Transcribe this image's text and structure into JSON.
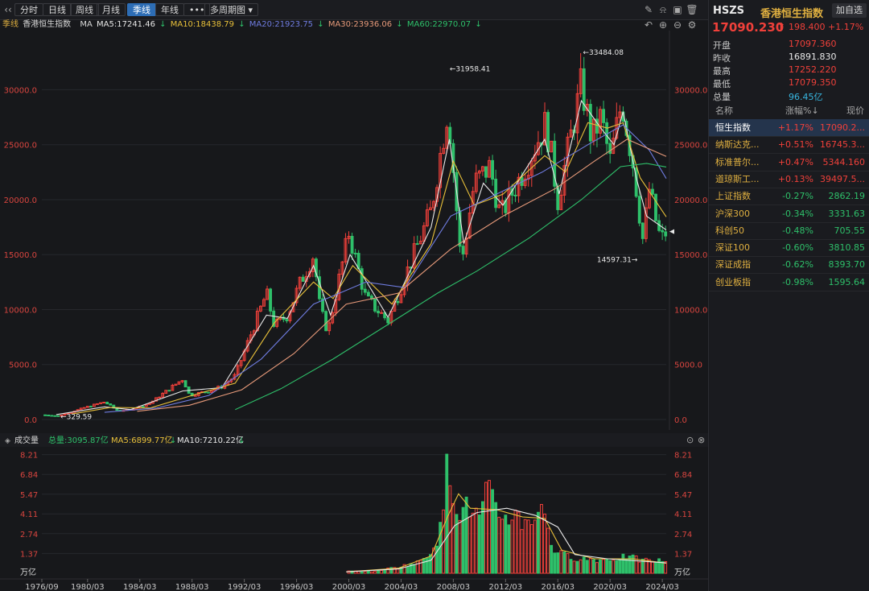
{
  "toolbar": {
    "periods": [
      "分时",
      "日线",
      "周线",
      "月线",
      "季线",
      "年线"
    ],
    "active_period": "季线",
    "more_label": "•••",
    "multi_period_label": "多周期图"
  },
  "ma_bar": {
    "period_label": "季线",
    "index_name": "香港恒生指数",
    "ma_label": "MA",
    "ma5": "MA5:17241.46",
    "ma10": "MA10:18438.79",
    "ma20": "MA20:21923.75",
    "ma30": "MA30:23936.06",
    "ma60": "MA60:22970.07",
    "down_arrow": "↓"
  },
  "volume_bar": {
    "title": "成交量",
    "total": "总量:3095.87亿",
    "ma5": "MA5:6899.77亿",
    "ma10": "MA10:7210.22亿",
    "down_arrow": "↓"
  },
  "colors": {
    "up": "#f0403a",
    "down": "#2ec06a",
    "ma5": "#e8e8e8",
    "ma10": "#e8c03a",
    "ma20": "#6f7ce0",
    "ma30": "#e79a7a",
    "ma60": "#2ec06a",
    "accent": "#2d6db5"
  },
  "quote": {
    "code": "HSZS",
    "name": "香港恒生指数",
    "add_label": "加自选",
    "price": "17090.230",
    "change": "198.400",
    "change_pct": "+1.17%",
    "fields": [
      {
        "label": "开盘",
        "value": "17097.360"
      },
      {
        "label": "昨收",
        "value": "16891.830"
      },
      {
        "label": "最高",
        "value": "17252.220"
      },
      {
        "label": "最低",
        "value": "17079.350"
      },
      {
        "label": "总量",
        "value": "96.45亿"
      }
    ]
  },
  "index_table": {
    "headers": [
      "名称",
      "涨幅%↓",
      "现价"
    ],
    "rows": [
      {
        "name": "恒生指数",
        "pct": "+1.17%",
        "price": "17090.2..."
      },
      {
        "name": "纳斯达克...",
        "pct": "+0.51%",
        "price": "16745.3..."
      },
      {
        "name": "标准普尔...",
        "pct": "+0.47%",
        "price": "5344.160"
      },
      {
        "name": "道琼斯工...",
        "pct": "+0.13%",
        "price": "39497.5..."
      },
      {
        "name": "上证指数",
        "pct": "-0.27%",
        "price": "2862.19"
      },
      {
        "name": "沪深300",
        "pct": "-0.34%",
        "price": "3331.63"
      },
      {
        "name": "科创50",
        "pct": "-0.48%",
        "price": "705.55"
      },
      {
        "name": "深证100",
        "pct": "-0.60%",
        "price": "3810.85"
      },
      {
        "name": "深证成指",
        "pct": "-0.62%",
        "price": "8393.70"
      },
      {
        "name": "创业板指",
        "pct": "-0.98%",
        "price": "1595.64"
      }
    ]
  },
  "chart_data": {
    "type": "candlestick",
    "price_axis": {
      "ticks": [
        0,
        5000,
        10000,
        15000,
        20000,
        25000,
        30000
      ],
      "tick_labels": [
        "0.0",
        "5000.0",
        "10000.0",
        "15000.0",
        "20000.0",
        "25000.0",
        "30000.0"
      ],
      "ylim": [
        0,
        34500
      ]
    },
    "volume_axis": {
      "ticks": [
        1.37,
        2.74,
        4.11,
        5.47,
        6.84,
        8.21
      ],
      "tick_labels": [
        "1.37",
        "2.74",
        "4.11",
        "5.47",
        "6.84",
        "8.21"
      ],
      "unit": "万亿",
      "ylim": [
        0,
        8.3
      ]
    },
    "x_labels": [
      "1976/09",
      "1980/03",
      "1984/03",
      "1988/03",
      "1992/03",
      "1996/03",
      "2000/03",
      "2004/03",
      "2008/03",
      "2012/03",
      "2016/03",
      "2020/03",
      "2024/03"
    ],
    "x_range": [
      1976.7,
      2024.5
    ],
    "annotations": [
      {
        "text": "329.59",
        "x": 1978.0,
        "y": 329.59
      },
      {
        "text": "31958.41",
        "x": 2007.8,
        "y": 31958.41
      },
      {
        "text": "33484.08",
        "x": 2018.0,
        "y": 33484.08
      },
      {
        "text": "14597.31",
        "x": 2022.8,
        "y": 14597.31
      }
    ],
    "last_price": 17090.23,
    "close_series": [
      {
        "x": 1976.7,
        "y": 420
      },
      {
        "x": 1978.0,
        "y": 330
      },
      {
        "x": 1979.0,
        "y": 700
      },
      {
        "x": 1980.0,
        "y": 1100
      },
      {
        "x": 1981.5,
        "y": 1600
      },
      {
        "x": 1982.5,
        "y": 800
      },
      {
        "x": 1983.5,
        "y": 900
      },
      {
        "x": 1985.0,
        "y": 1500
      },
      {
        "x": 1987.5,
        "y": 3700
      },
      {
        "x": 1988.0,
        "y": 2200
      },
      {
        "x": 1989.5,
        "y": 2600
      },
      {
        "x": 1990.5,
        "y": 3000
      },
      {
        "x": 1991.5,
        "y": 4000
      },
      {
        "x": 1993.9,
        "y": 11500
      },
      {
        "x": 1994.5,
        "y": 8500
      },
      {
        "x": 1995.5,
        "y": 9500
      },
      {
        "x": 1996.5,
        "y": 12500
      },
      {
        "x": 1997.5,
        "y": 15000
      },
      {
        "x": 1998.0,
        "y": 10000
      },
      {
        "x": 1998.6,
        "y": 8000
      },
      {
        "x": 2000.2,
        "y": 17000
      },
      {
        "x": 2001.5,
        "y": 11000
      },
      {
        "x": 2003.2,
        "y": 9000
      },
      {
        "x": 2004.5,
        "y": 13000
      },
      {
        "x": 2006.5,
        "y": 19000
      },
      {
        "x": 2007.8,
        "y": 28500
      },
      {
        "x": 2008.8,
        "y": 14000
      },
      {
        "x": 2009.8,
        "y": 21500
      },
      {
        "x": 2011.0,
        "y": 23000
      },
      {
        "x": 2011.8,
        "y": 18500
      },
      {
        "x": 2013.5,
        "y": 22500
      },
      {
        "x": 2015.3,
        "y": 27000
      },
      {
        "x": 2016.2,
        "y": 20000
      },
      {
        "x": 2018.0,
        "y": 30500
      },
      {
        "x": 2018.8,
        "y": 25500
      },
      {
        "x": 2019.5,
        "y": 27500
      },
      {
        "x": 2020.2,
        "y": 23500
      },
      {
        "x": 2021.1,
        "y": 29000
      },
      {
        "x": 2022.0,
        "y": 23000
      },
      {
        "x": 2022.8,
        "y": 15500
      },
      {
        "x": 2023.1,
        "y": 21500
      },
      {
        "x": 2023.9,
        "y": 17000
      },
      {
        "x": 2024.2,
        "y": 16500
      },
      {
        "x": 2024.5,
        "y": 17090
      }
    ],
    "ma_series": [
      {
        "name": "MA5",
        "points": [
          {
            "x": 1977.8,
            "y": 450
          },
          {
            "x": 1981.5,
            "y": 1150
          },
          {
            "x": 1983.5,
            "y": 900
          },
          {
            "x": 1987.5,
            "y": 2600
          },
          {
            "x": 1990.5,
            "y": 2900
          },
          {
            "x": 1993.9,
            "y": 9500
          },
          {
            "x": 1995.5,
            "y": 9200
          },
          {
            "x": 1997.5,
            "y": 14000
          },
          {
            "x": 1998.8,
            "y": 9500
          },
          {
            "x": 2000.3,
            "y": 15000
          },
          {
            "x": 2003.2,
            "y": 9300
          },
          {
            "x": 2006.5,
            "y": 17500
          },
          {
            "x": 2007.9,
            "y": 25500
          },
          {
            "x": 2009.0,
            "y": 16000
          },
          {
            "x": 2010.5,
            "y": 21500
          },
          {
            "x": 2012.0,
            "y": 19500
          },
          {
            "x": 2015.2,
            "y": 25500
          },
          {
            "x": 2016.3,
            "y": 20500
          },
          {
            "x": 2018.0,
            "y": 29000
          },
          {
            "x": 2019.5,
            "y": 26500
          },
          {
            "x": 2020.5,
            "y": 25000
          },
          {
            "x": 2021.2,
            "y": 28000
          },
          {
            "x": 2022.2,
            "y": 22000
          },
          {
            "x": 2023.0,
            "y": 18500
          },
          {
            "x": 2024.5,
            "y": 17241
          }
        ]
      },
      {
        "name": "MA10",
        "points": [
          {
            "x": 1979.0,
            "y": 500
          },
          {
            "x": 1982.0,
            "y": 1100
          },
          {
            "x": 1985.0,
            "y": 1050
          },
          {
            "x": 1988.5,
            "y": 2300
          },
          {
            "x": 1991.5,
            "y": 3300
          },
          {
            "x": 1994.5,
            "y": 8800
          },
          {
            "x": 1997.5,
            "y": 12500
          },
          {
            "x": 1999.0,
            "y": 11000
          },
          {
            "x": 2000.5,
            "y": 14000
          },
          {
            "x": 2003.5,
            "y": 10500
          },
          {
            "x": 2006.5,
            "y": 16000
          },
          {
            "x": 2008.2,
            "y": 23500
          },
          {
            "x": 2009.8,
            "y": 19500
          },
          {
            "x": 2012.0,
            "y": 20500
          },
          {
            "x": 2015.2,
            "y": 24000
          },
          {
            "x": 2016.8,
            "y": 22500
          },
          {
            "x": 2018.5,
            "y": 27000
          },
          {
            "x": 2020.0,
            "y": 26500
          },
          {
            "x": 2021.2,
            "y": 27000
          },
          {
            "x": 2022.5,
            "y": 22000
          },
          {
            "x": 2024.5,
            "y": 18438
          }
        ]
      },
      {
        "name": "MA20",
        "points": [
          {
            "x": 1981.5,
            "y": 650
          },
          {
            "x": 1985.5,
            "y": 1050
          },
          {
            "x": 1989.5,
            "y": 2200
          },
          {
            "x": 1993.5,
            "y": 5500
          },
          {
            "x": 1997.5,
            "y": 10500
          },
          {
            "x": 2001.5,
            "y": 12500
          },
          {
            "x": 2004.5,
            "y": 12000
          },
          {
            "x": 2008.0,
            "y": 18500
          },
          {
            "x": 2011.5,
            "y": 20500
          },
          {
            "x": 2015.0,
            "y": 22500
          },
          {
            "x": 2018.5,
            "y": 25000
          },
          {
            "x": 2021.2,
            "y": 26800
          },
          {
            "x": 2023.2,
            "y": 24500
          },
          {
            "x": 2024.5,
            "y": 21923
          }
        ]
      },
      {
        "name": "MA30",
        "points": [
          {
            "x": 1984.0,
            "y": 750
          },
          {
            "x": 1988.0,
            "y": 1300
          },
          {
            "x": 1992.0,
            "y": 2700
          },
          {
            "x": 1996.0,
            "y": 6000
          },
          {
            "x": 2000.0,
            "y": 10500
          },
          {
            "x": 2004.0,
            "y": 11500
          },
          {
            "x": 2008.0,
            "y": 15500
          },
          {
            "x": 2012.0,
            "y": 18500
          },
          {
            "x": 2016.0,
            "y": 21000
          },
          {
            "x": 2019.0,
            "y": 23500
          },
          {
            "x": 2021.5,
            "y": 25500
          },
          {
            "x": 2024.5,
            "y": 23936
          }
        ]
      },
      {
        "name": "MA60",
        "points": [
          {
            "x": 1991.5,
            "y": 900
          },
          {
            "x": 1995.0,
            "y": 2800
          },
          {
            "x": 1999.0,
            "y": 5500
          },
          {
            "x": 2003.0,
            "y": 8500
          },
          {
            "x": 2007.0,
            "y": 11500
          },
          {
            "x": 2010.0,
            "y": 13500
          },
          {
            "x": 2014.0,
            "y": 16500
          },
          {
            "x": 2018.0,
            "y": 20000
          },
          {
            "x": 2021.0,
            "y": 23000
          },
          {
            "x": 2023.0,
            "y": 23300
          },
          {
            "x": 2024.5,
            "y": 22970
          }
        ]
      }
    ],
    "volume_series": [
      {
        "x": 2000.2,
        "y": 0.15
      },
      {
        "x": 2002.0,
        "y": 0.12
      },
      {
        "x": 2004.0,
        "y": 0.45
      },
      {
        "x": 2005.5,
        "y": 0.75
      },
      {
        "x": 2006.5,
        "y": 1.6
      },
      {
        "x": 2007.3,
        "y": 3.2
      },
      {
        "x": 2007.8,
        "y": 8.21
      },
      {
        "x": 2008.3,
        "y": 5.6
      },
      {
        "x": 2008.8,
        "y": 4.3
      },
      {
        "x": 2009.5,
        "y": 4.7
      },
      {
        "x": 2010.2,
        "y": 3.8
      },
      {
        "x": 2010.8,
        "y": 5.7
      },
      {
        "x": 2011.5,
        "y": 4.4
      },
      {
        "x": 2012.2,
        "y": 4.0
      },
      {
        "x": 2012.8,
        "y": 4.2
      },
      {
        "x": 2013.5,
        "y": 3.7
      },
      {
        "x": 2014.5,
        "y": 4.2
      },
      {
        "x": 2015.2,
        "y": 4.4
      },
      {
        "x": 2015.8,
        "y": 1.8
      },
      {
        "x": 2016.5,
        "y": 1.3
      },
      {
        "x": 2017.5,
        "y": 1.1
      },
      {
        "x": 2018.5,
        "y": 1.0
      },
      {
        "x": 2019.5,
        "y": 0.95
      },
      {
        "x": 2020.5,
        "y": 1.05
      },
      {
        "x": 2021.5,
        "y": 1.15
      },
      {
        "x": 2022.5,
        "y": 0.95
      },
      {
        "x": 2023.5,
        "y": 0.85
      },
      {
        "x": 2024.3,
        "y": 0.9
      }
    ],
    "volume_ma": [
      {
        "name": "MA5",
        "points": [
          {
            "x": 2000.0,
            "y": 0.1
          },
          {
            "x": 2004.0,
            "y": 0.35
          },
          {
            "x": 2006.5,
            "y": 1.2
          },
          {
            "x": 2007.8,
            "y": 4.0
          },
          {
            "x": 2008.6,
            "y": 5.5
          },
          {
            "x": 2009.5,
            "y": 4.5
          },
          {
            "x": 2011.5,
            "y": 4.4
          },
          {
            "x": 2013.5,
            "y": 3.9
          },
          {
            "x": 2015.2,
            "y": 3.8
          },
          {
            "x": 2016.5,
            "y": 1.6
          },
          {
            "x": 2019.0,
            "y": 1.0
          },
          {
            "x": 2022.0,
            "y": 1.0
          },
          {
            "x": 2024.5,
            "y": 0.69
          }
        ]
      },
      {
        "name": "MA10",
        "points": [
          {
            "x": 2000.0,
            "y": 0.1
          },
          {
            "x": 2004.0,
            "y": 0.3
          },
          {
            "x": 2006.5,
            "y": 0.9
          },
          {
            "x": 2008.3,
            "y": 3.3
          },
          {
            "x": 2010.0,
            "y": 4.2
          },
          {
            "x": 2012.3,
            "y": 4.5
          },
          {
            "x": 2014.5,
            "y": 4.0
          },
          {
            "x": 2016.2,
            "y": 3.2
          },
          {
            "x": 2017.5,
            "y": 1.3
          },
          {
            "x": 2020.0,
            "y": 1.0
          },
          {
            "x": 2024.5,
            "y": 0.72
          }
        ]
      }
    ]
  }
}
